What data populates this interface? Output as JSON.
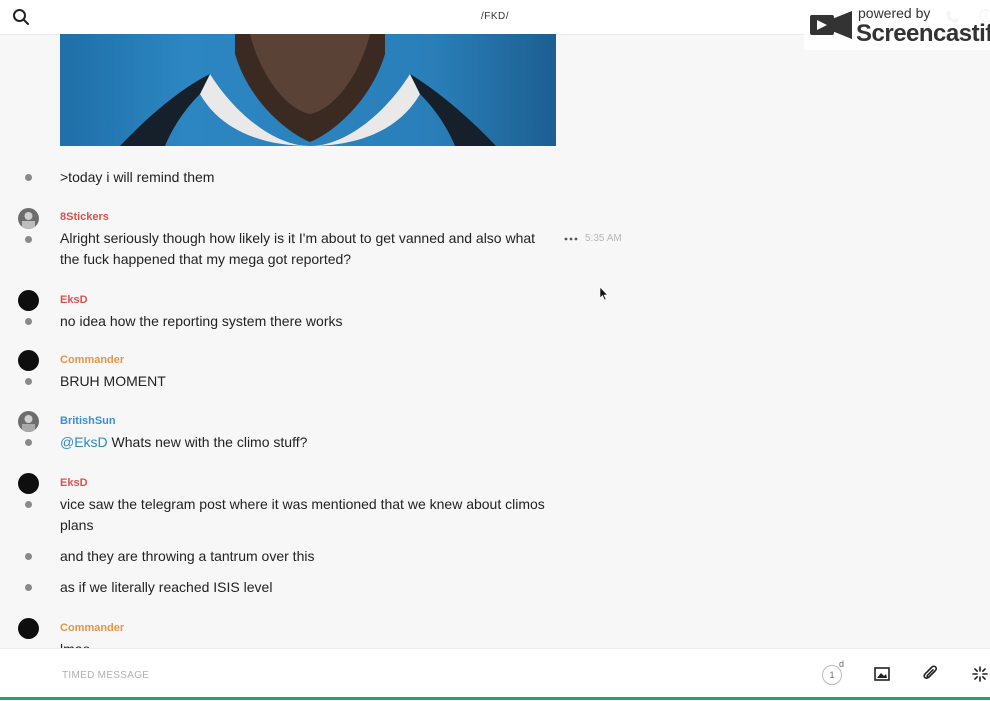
{
  "header": {
    "channel": "/FKD/"
  },
  "watermark": {
    "small": "powered by",
    "big": "Screencastify"
  },
  "messages": [
    {
      "text": ">today i will remind them"
    },
    {
      "author": "8Stickers",
      "text": "Alright seriously though how likely is it I'm about to get vanned and also what the fuck happened that my mega got reported?",
      "time": "5:35 AM"
    },
    {
      "author": "EksD",
      "text": "no idea how the reporting system there works"
    },
    {
      "author": "Commander",
      "text": "BRUH MOMENT"
    },
    {
      "author": "BritishSun",
      "mention": "@EksD",
      "text": " Whats new with the climo stuff?"
    },
    {
      "author": "EksD",
      "text": "vice saw the telegram post where it was mentioned that we knew about climos plans"
    },
    {
      "text": "and they are throwing a tantrum over this"
    },
    {
      "text": "as if we literally reached ISIS level"
    },
    {
      "author": "Commander",
      "text": "lmao"
    }
  ],
  "composer": {
    "placeholder": "TIMED MESSAGE",
    "timer_value": "1",
    "timer_unit": "d"
  },
  "colors": {
    "author_red": "#d9534f",
    "author_orange": "#e69545",
    "author_blue": "#3a8fd6",
    "mention": "#2e8bc0",
    "accent_bar": "#1fa66a"
  },
  "icons": [
    "search-icon",
    "phone-icon",
    "info-icon",
    "more-icon",
    "cursor-icon",
    "timer-icon",
    "image-icon",
    "paperclip-icon",
    "sparkle-icon"
  ]
}
